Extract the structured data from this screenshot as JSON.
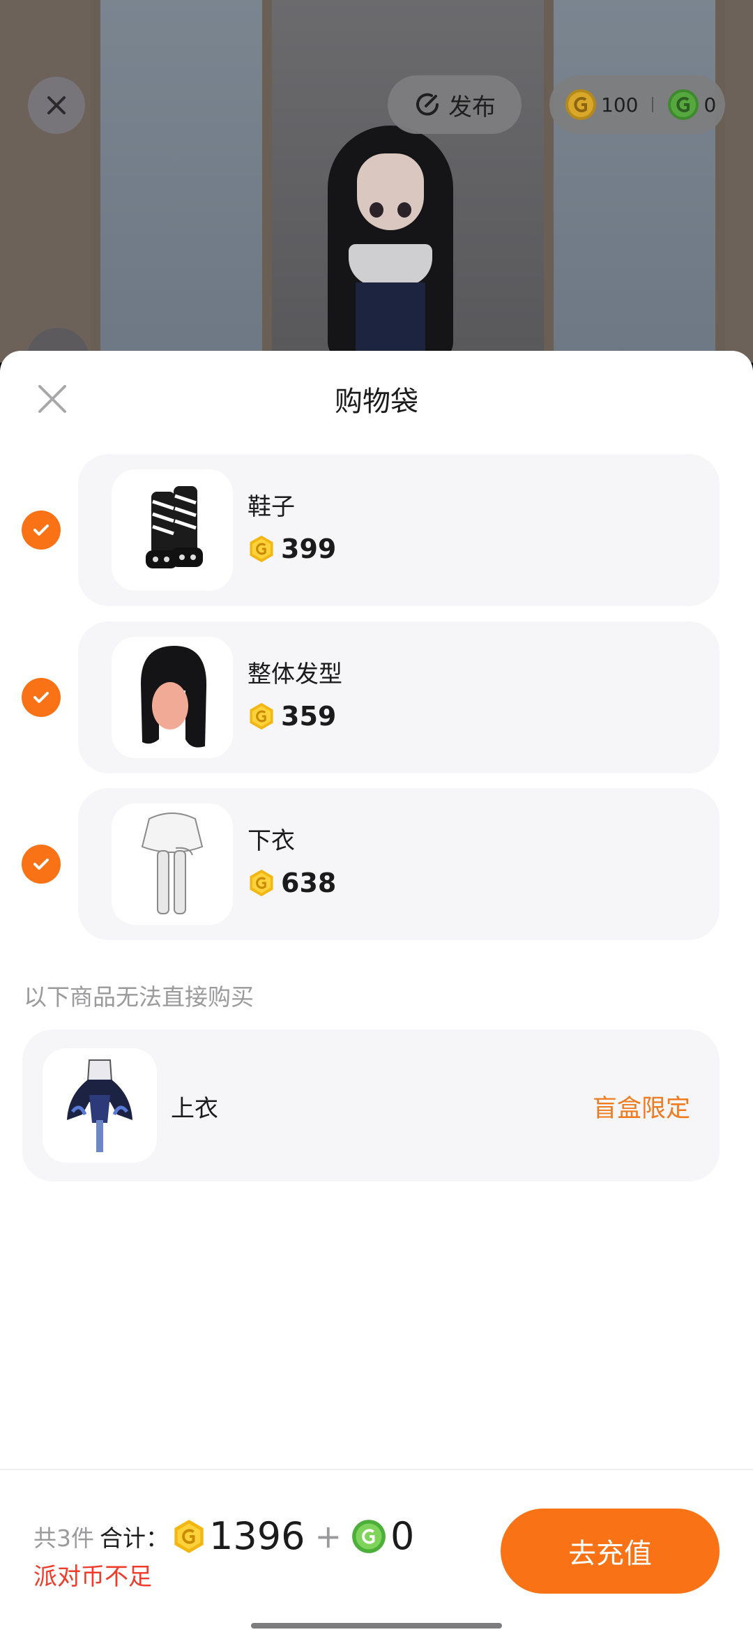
{
  "scene": {
    "publish_label": "发布",
    "balance_coin": "100",
    "balance_green": "0"
  },
  "sheet": {
    "title": "购物袋",
    "items": [
      {
        "name": "鞋子",
        "price": "399",
        "checked": true,
        "thumb": "shoes-thumbnail"
      },
      {
        "name": "整体发型",
        "price": "359",
        "checked": true,
        "thumb": "hairstyle-thumbnail"
      },
      {
        "name": "下衣",
        "price": "638",
        "checked": true,
        "thumb": "bottom-thumbnail"
      }
    ],
    "unavailable_label": "以下商品无法直接购买",
    "unavailable_items": [
      {
        "name": "上衣",
        "tag": "盲盒限定",
        "thumb": "top-thumbnail"
      }
    ]
  },
  "footer": {
    "count": "共3件",
    "total_label": "合计：",
    "coin_total": "1396",
    "plus": "+",
    "green_total": "0",
    "warning": "派对币不足",
    "recharge_label": "去充值"
  },
  "colors": {
    "accent": "#f97316",
    "warning": "#ef3b2a",
    "tag": "#f07a1e",
    "card_bg": "#f6f6f8"
  }
}
